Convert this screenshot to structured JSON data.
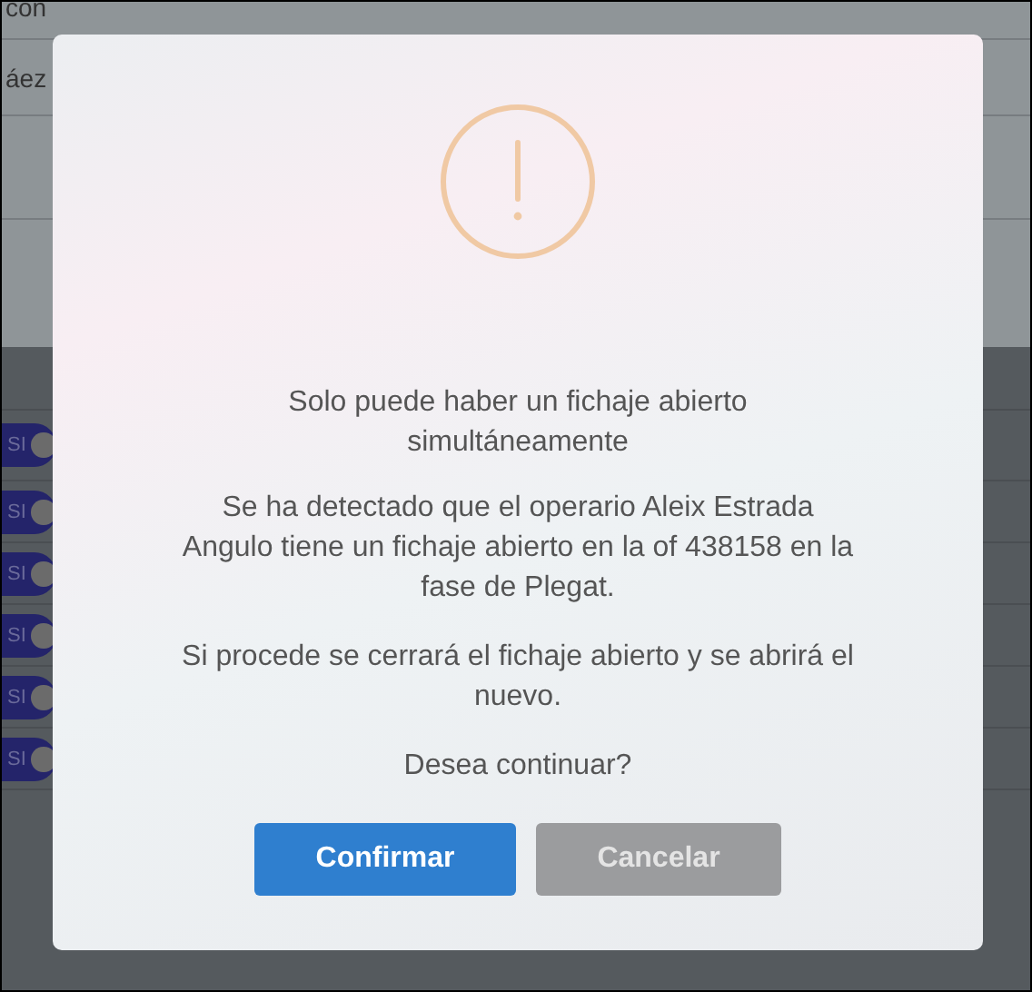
{
  "background": {
    "rows": [
      "con",
      "áez"
    ],
    "toggles": [
      {
        "label": "SI",
        "on": true
      },
      {
        "label": "SI",
        "on": true
      },
      {
        "label": "SI",
        "on": true
      },
      {
        "label": "SI",
        "on": true
      },
      {
        "label": "SI",
        "on": true
      },
      {
        "label": "SI",
        "on": true
      }
    ]
  },
  "dialog": {
    "title": "Solo puede haber un fichaje abierto simultáneamente",
    "paragraphs": [
      "Se ha detectado que el operario Aleix Estrada Angulo tiene un fichaje abierto en la of 438158 en la fase de Plegat.",
      "Si procede se cerrará el fichaje abierto y se abrirá el nuevo.",
      "Desea continuar?"
    ],
    "buttons": [
      {
        "label": "Confirmar",
        "kind": "primary"
      },
      {
        "label": "Cancelar",
        "kind": "secondary"
      }
    ]
  }
}
